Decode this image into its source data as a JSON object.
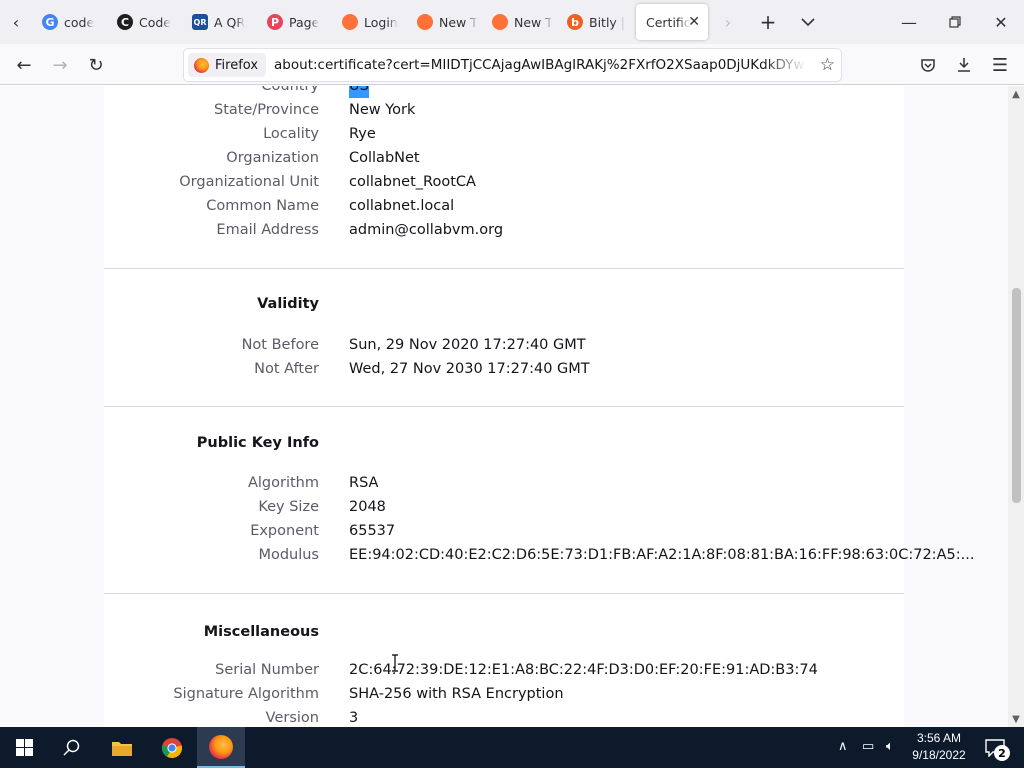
{
  "browser": {
    "tabs": [
      {
        "label": "code",
        "favicon": "google-icon",
        "color": "#4285f4",
        "glyph": "G"
      },
      {
        "label": "Code",
        "favicon": "codecademy-icon",
        "color": "#1f1f1f",
        "glyph": "C"
      },
      {
        "label": "A QR",
        "favicon": "qr-code-generator-icon",
        "color": "#1c4fa0",
        "glyph": "QR"
      },
      {
        "label": "Page",
        "favicon": "page-icon",
        "color": "#e2475b",
        "glyph": "P"
      },
      {
        "label": "Login",
        "favicon": "firefox-icon",
        "color": "#ff7139",
        "glyph": ""
      },
      {
        "label": "New T",
        "favicon": "firefox-icon",
        "color": "#ff7139",
        "glyph": ""
      },
      {
        "label": "New T",
        "favicon": "firefox-icon",
        "color": "#ff7139",
        "glyph": ""
      },
      {
        "label": "Bitly |",
        "favicon": "bitly-icon",
        "color": "#ee6123",
        "glyph": "b"
      }
    ],
    "active_tab": {
      "label": "Certific"
    },
    "identity_label": "Firefox",
    "url": "about:certificate?cert=MIIDTjCCAjagAwIBAgIRAKj%2FXrfO2XSaap0DjUKdkDYwDQYJKoZ"
  },
  "certificate": {
    "subject_rows": [
      {
        "key": "Country",
        "value": "US"
      },
      {
        "key": "State/Province",
        "value": "New York"
      },
      {
        "key": "Locality",
        "value": "Rye"
      },
      {
        "key": "Organization",
        "value": "CollabNet"
      },
      {
        "key": "Organizational Unit",
        "value": "collabnet_RootCA"
      },
      {
        "key": "Common Name",
        "value": "collabnet.local"
      },
      {
        "key": "Email Address",
        "value": "admin@collabvm.org"
      }
    ],
    "validity": {
      "title": "Validity",
      "rows": [
        {
          "key": "Not Before",
          "value": "Sun, 29 Nov 2020 17:27:40 GMT"
        },
        {
          "key": "Not After",
          "value": "Wed, 27 Nov 2030 17:27:40 GMT"
        }
      ]
    },
    "public_key": {
      "title": "Public Key Info",
      "rows": [
        {
          "key": "Algorithm",
          "value": "RSA"
        },
        {
          "key": "Key Size",
          "value": "2048"
        },
        {
          "key": "Exponent",
          "value": "65537"
        },
        {
          "key": "Modulus",
          "value": "EE:94:02:CD:40:E2:C2:D6:5E:73:D1:FB:AF:A2:1A:8F:08:81:BA:16:FF:98:63:0C:72:A5:..."
        }
      ]
    },
    "misc": {
      "title": "Miscellaneous",
      "rows": [
        {
          "key": "Serial Number",
          "value": "2C:64:72:39:DE:12:E1:A8:BC:22:4F:D3:D0:EF:20:FE:91:AD:B3:74"
        },
        {
          "key": "Signature Algorithm",
          "value": "SHA-256 with RSA Encryption"
        },
        {
          "key": "Version",
          "value": "3"
        }
      ]
    }
  },
  "taskbar": {
    "time": "3:56 AM",
    "date": "9/18/2022",
    "notification_count": "2"
  },
  "colors": {
    "accent": "#0060df",
    "selection": "#3399ff",
    "taskbar": "#0d1a2b"
  }
}
